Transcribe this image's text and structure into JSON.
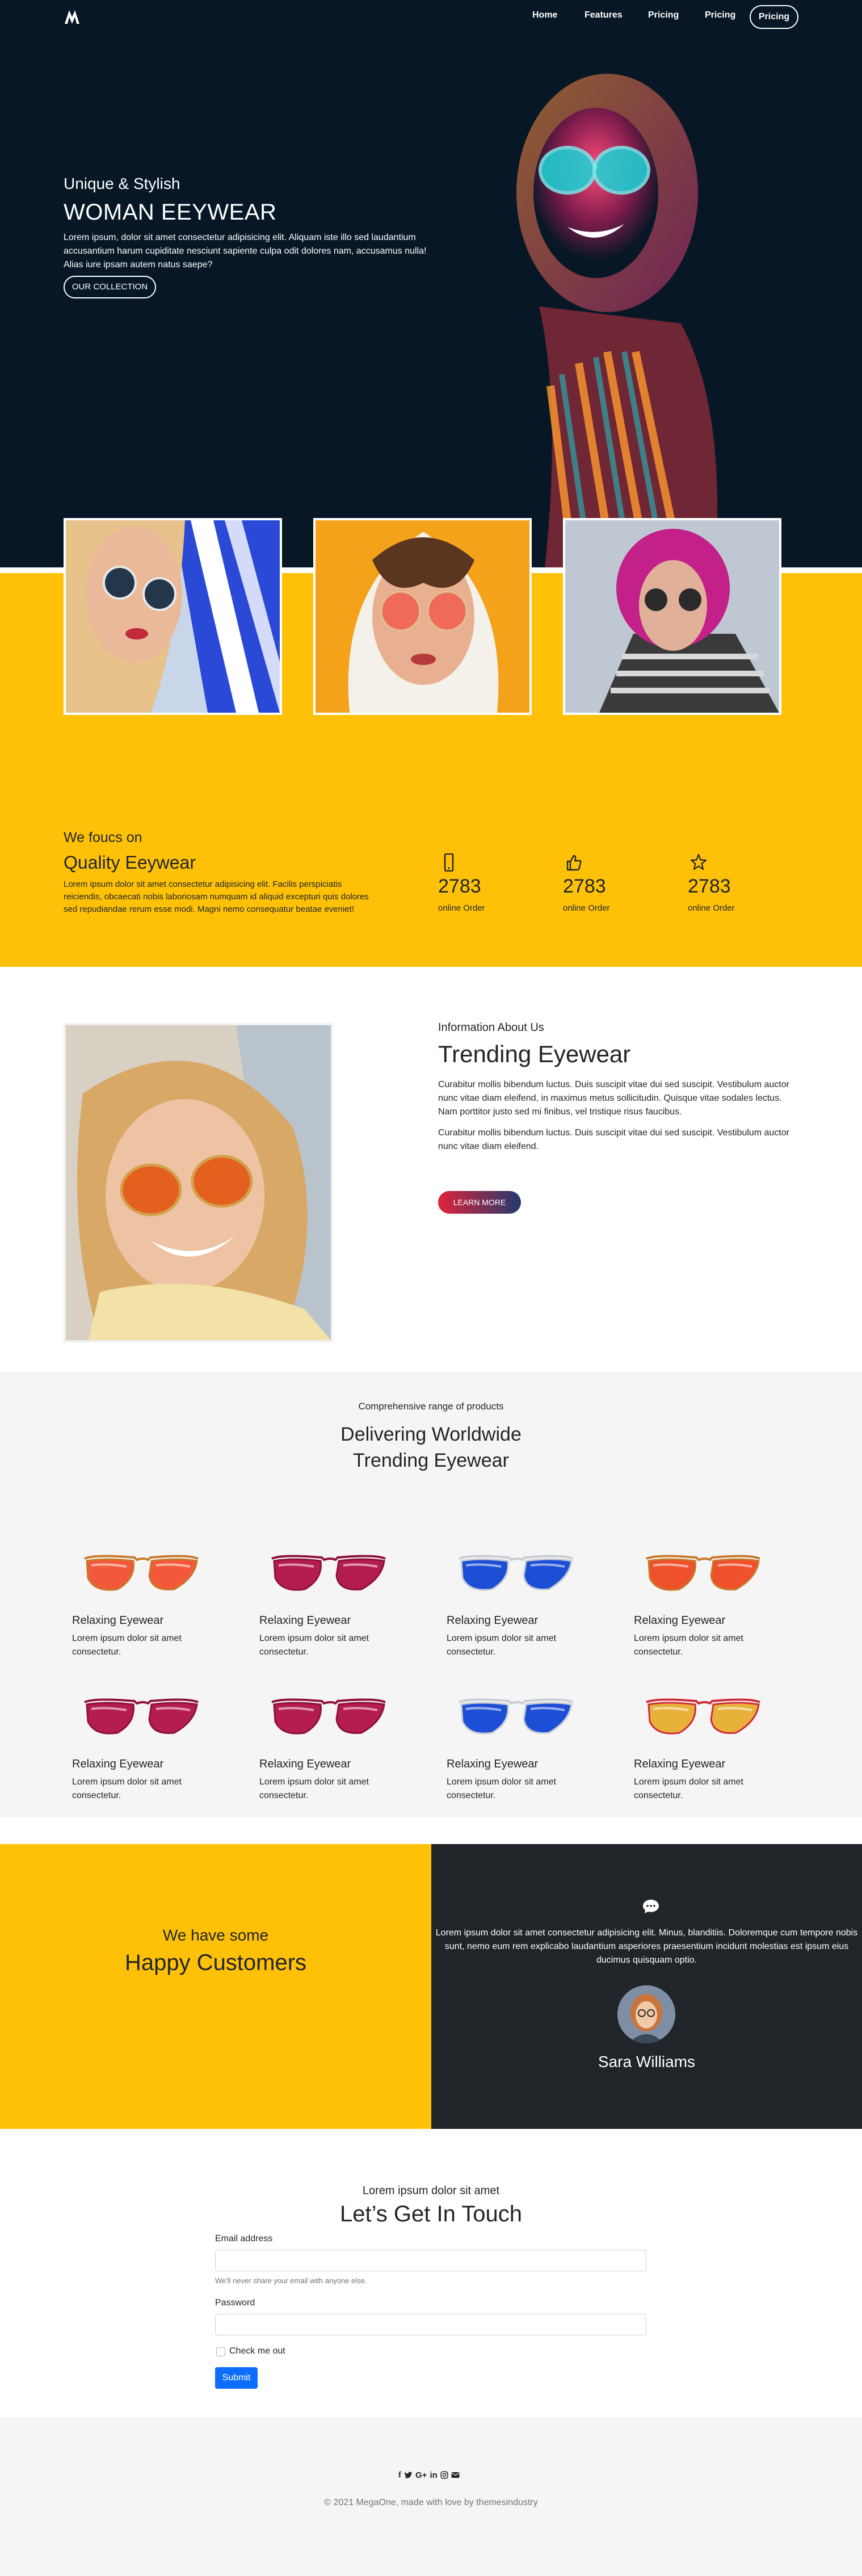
{
  "nav": {
    "logo": "M",
    "links": [
      "Home",
      "Features",
      "Pricing",
      "Pricing"
    ],
    "cta": "Pricing"
  },
  "hero": {
    "subtitle": "Unique & Stylish",
    "title": "WOMAN EEYWEAR",
    "text": "Lorem ipsum, dolor sit amet consectetur adipisicing elit. Aliquam iste illo sed laudantium accusantium harum cupiditate nesciunt sapiente culpa odit dolores nam, accusamus nulla! Alias iure ipsam autem natus saepe?",
    "button": "OUR COLLECTION"
  },
  "focus": {
    "subtitle": "We foucs on",
    "title": "Quality Eeywear",
    "text": "Lorem ipsum dolor sit amet consectetur adipisicing elit. Facilis perspiciatis reiciendis, obcaecati nobis laboriosam numquam id aliquid excepturi quis dolores sed repudiandae rerum esse modi. Magni nemo consequatur beatae eveniet!",
    "stats": [
      {
        "icon": "phone-icon",
        "number": "2783",
        "label": "online Order"
      },
      {
        "icon": "thumbs-up-icon",
        "number": "2783",
        "label": "online Order"
      },
      {
        "icon": "star-icon",
        "number": "2783",
        "label": "online Order"
      }
    ]
  },
  "trending": {
    "subtitle": "Information About Us",
    "title": "Trending Eyewear",
    "p1": "Curabitur mollis bibendum luctus. Duis suscipit vitae dui sed suscipit. Vestibulum auctor nunc vitae diam eleifend, in maximus metus sollicitudin. Quisque vitae sodales lectus. Nam porttitor justo sed mi finibus, vel tristique risus faucibus.",
    "p2": "Curabitur mollis bibendum luctus. Duis suscipit vitae dui sed suscipit. Vestibulum auctor nunc vitae diam eleifend.",
    "button": "LEARN MORE"
  },
  "products": {
    "subtitle": "Comprehensive range of products",
    "title_line1": "Delivering Worldwide",
    "title_line2": "Trending Eyewear",
    "items": [
      {
        "name": "Relaxing Eyewear",
        "desc": "Lorem ipsum dolor sit amet consectetur.",
        "lens": "#f2593a",
        "frame": "#c77a2a"
      },
      {
        "name": "Relaxing Eyewear",
        "desc": "Lorem ipsum dolor sit amet consectetur.",
        "lens": "#b31d4d",
        "frame": "#8e1239"
      },
      {
        "name": "Relaxing Eyewear",
        "desc": "Lorem ipsum dolor sit amet consectetur.",
        "lens": "#1d4fd6",
        "frame": "#c9ccd4"
      },
      {
        "name": "Relaxing Eyewear",
        "desc": "Lorem ipsum dolor sit amet consectetur.",
        "lens": "#f0512d",
        "frame": "#c77a2a"
      },
      {
        "name": "Relaxing Eyewear",
        "desc": "Lorem ipsum dolor sit amet consectetur.",
        "lens": "#b51c4f",
        "frame": "#8e1239"
      },
      {
        "name": "Relaxing Eyewear",
        "desc": "Lorem ipsum dolor sit amet consectetur.",
        "lens": "#b51c4f",
        "frame": "#8e1239"
      },
      {
        "name": "Relaxing Eyewear",
        "desc": "Lorem ipsum dolor sit amet consectetur.",
        "lens": "#1d4fd6",
        "frame": "#c9ccd4"
      },
      {
        "name": "Relaxing Eyewear",
        "desc": "Lorem ipsum dolor sit amet consectetur.",
        "lens": "#e8b23a",
        "frame": "#cf2d3a"
      }
    ]
  },
  "testimonial": {
    "subtitle": "We have some",
    "title": "Happy Customers",
    "text": "Lorem ipsum dolor sit amet consectetur adipisicing elit. Minus, blanditiis. Doloremque cum tempore nobis sunt, nemo eum rem explicabo laudantium asperiores praesentium incidunt molestias est ipsum eius ducimus quisquam optio.",
    "name": "Sara Williams"
  },
  "contact": {
    "subtitle": "Lorem ipsum dolor sit amet",
    "title": "Let’s Get In Touch",
    "email_label": "Email address",
    "email_help": "We'll never share your email with anyone else.",
    "password_label": "Password",
    "checkbox_label": "Check me out",
    "submit": "Submit"
  },
  "footer": {
    "social": [
      "f",
      "t",
      "G+",
      "in",
      "ig",
      "mail"
    ],
    "copyright": "© 2021 MegaOne, made with love by themesindustry"
  },
  "colors": {
    "hero_bg": "#071726",
    "accent_yellow": "#ffc107",
    "dark_panel": "#212429",
    "submit_blue": "#0d6efd"
  }
}
